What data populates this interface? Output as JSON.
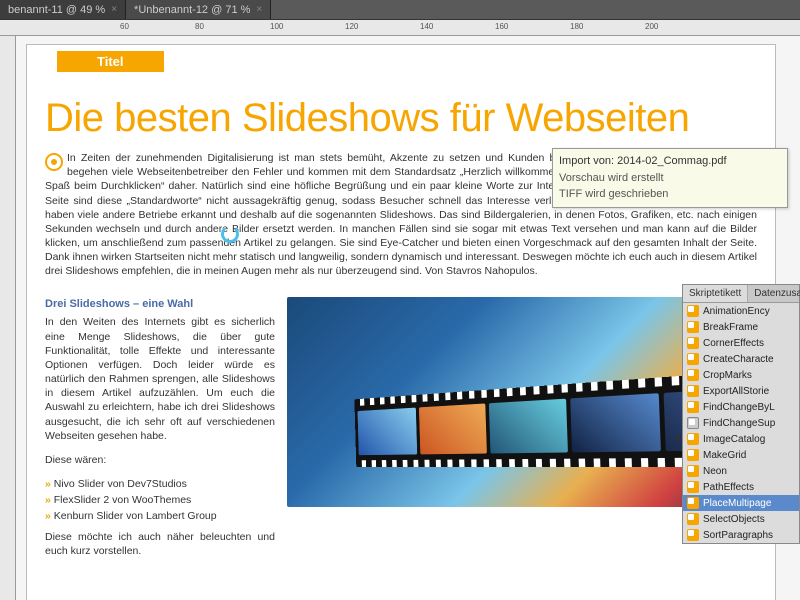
{
  "tabs": [
    {
      "label": "benannt-11 @ 49 %"
    },
    {
      "label": "*Unbenannt-12 @ 71 %"
    }
  ],
  "ruler_ticks": [
    "60",
    "80",
    "100",
    "120",
    "140",
    "160",
    "180",
    "200"
  ],
  "page": {
    "title_bar": "Titel",
    "headline": "Die besten Slideshows für Webseiten",
    "intro": "In Zeiten der zunehmenden Digitalisierung ist man stets bemüht, Akzente zu setzen und Kunden bzw. User aufmerksam zu machen. Leider begehen viele Webseitenbetreiber den Fehler und kommen mit dem Standardsatz „Herzlich willkommen auf unserer Webseite […] haben Sie viel Spaß beim Durchklicken“ daher. Natürlich sind eine höfliche Begrüßung und ein paar kleine Worte zur Internetpräsenz sinnvoll, aber auf der anderen Seite sind diese „Standardworte“ nicht aussagekräftig genug, sodass Besucher schnell das Interesse verlieren und die Page verlassen. Gerade das haben viele andere Betriebe erkannt und deshalb auf die sogenannten Slideshows. Das sind Bildergalerien, in denen Fotos, Grafiken, etc. nach einigen Sekunden wechseln und durch andere Bilder ersetzt werden. In manchen Fällen sind sie sogar mit etwas Text versehen und man kann auf die Bilder klicken, um anschließend zum passenden Artikel zu gelangen. Sie sind Eye-Catcher und bieten einen Vorgeschmack auf den gesamten Inhalt der Seite. Dank ihnen wirken Startseiten nicht mehr statisch und langweilig, sondern dynamisch und interessant. Deswegen möchte ich euch auch in diesem Artikel drei Slideshows empfehlen, die in meinen Augen mehr als nur überzeugend sind. Von Stavros Nahopulos.",
    "sub_heading": "Drei Slideshows – eine Wahl",
    "col_p1": "In den Weiten des Internets gibt es sicherlich eine Menge Slideshows, die über gute Funktionalität, tolle Effekte und interessante Optionen verfügen. Doch leider würde es natürlich den Rahmen sprengen, alle Slideshows in diesem Artikel aufzuzählen. Um euch die Auswahl zu erleichtern, habe ich drei Slideshows ausgesucht, die ich sehr oft auf verschiedenen Webseiten gesehen habe.",
    "col_p2": "Diese wären:",
    "bullets": [
      "Nivo Slider von Dev7Studios",
      "FlexSlider 2 von WooThemes",
      "Kenburn Slider von Lambert Group"
    ],
    "col_p3": "Diese möchte ich auch näher beleuchten und euch kurz vorstellen."
  },
  "tooltip": {
    "title": "Import von: 2014-02_Commag.pdf",
    "line1": "Vorschau wird erstellt",
    "line2": "TIFF wird geschrieben"
  },
  "panel": {
    "tab1": "Skriptetikett",
    "tab2": "Datenzusamm",
    "items": [
      {
        "label": "AnimationEncy",
        "type": "script"
      },
      {
        "label": "BreakFrame",
        "type": "script"
      },
      {
        "label": "CornerEffects",
        "type": "script"
      },
      {
        "label": "CreateCharacte",
        "type": "script"
      },
      {
        "label": "CropMarks",
        "type": "script"
      },
      {
        "label": "ExportAllStorie",
        "type": "script"
      },
      {
        "label": "FindChangeByL",
        "type": "script"
      },
      {
        "label": "FindChangeSup",
        "type": "folder"
      },
      {
        "label": "ImageCatalog",
        "type": "script"
      },
      {
        "label": "MakeGrid",
        "type": "script"
      },
      {
        "label": "Neon",
        "type": "script"
      },
      {
        "label": "PathEffects",
        "type": "script"
      },
      {
        "label": "PlaceMultipage",
        "type": "script",
        "selected": true
      },
      {
        "label": "SelectObjects",
        "type": "script"
      },
      {
        "label": "SortParagraphs",
        "type": "script"
      }
    ]
  }
}
